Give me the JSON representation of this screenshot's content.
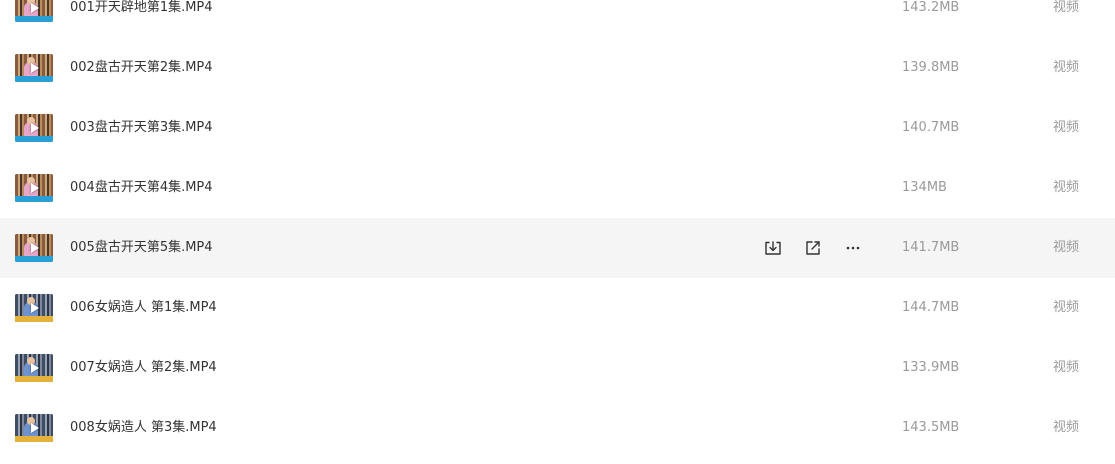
{
  "files": [
    {
      "name": "001开天辟地第1集.MP4",
      "size": "143.2MB",
      "type": "视频",
      "thumb": "v1"
    },
    {
      "name": "002盘古开天第2集.MP4",
      "size": "139.8MB",
      "type": "视频",
      "thumb": "v1"
    },
    {
      "name": "003盘古开天第3集.MP4",
      "size": "140.7MB",
      "type": "视频",
      "thumb": "v1"
    },
    {
      "name": "004盘古开天第4集.MP4",
      "size": "134MB",
      "type": "视频",
      "thumb": "v1"
    },
    {
      "name": "005盘古开天第5集.MP4",
      "size": "141.7MB",
      "type": "视频",
      "thumb": "v1",
      "hovered": true
    },
    {
      "name": "006女娲造人 第1集.MP4",
      "size": "144.7MB",
      "type": "视频",
      "thumb": "v2"
    },
    {
      "name": "007女娲造人 第2集.MP4",
      "size": "133.9MB",
      "type": "视频",
      "thumb": "v2"
    },
    {
      "name": "008女娲造人 第3集.MP4",
      "size": "143.5MB",
      "type": "视频",
      "thumb": "v2"
    }
  ],
  "row_actions": {
    "download_icon": "download-icon",
    "share_icon": "share-icon",
    "more_icon": "more-icon"
  },
  "colors": {
    "hover_bg": "#f5f5f6",
    "name_text": "#333333",
    "meta_text": "#9a9a9a"
  }
}
